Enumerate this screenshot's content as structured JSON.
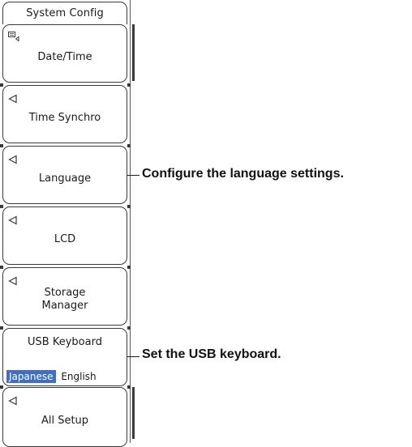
{
  "menu": {
    "title": "System Config",
    "keys": [
      {
        "label": "Date/Time",
        "icon": "menu-icon"
      },
      {
        "label": "Time Synchro",
        "icon": "left-triangle-icon"
      },
      {
        "label": "Language",
        "icon": "left-triangle-icon"
      },
      {
        "label": "LCD",
        "icon": "left-triangle-icon"
      },
      {
        "label": "Storage\nManager",
        "icon": "left-triangle-icon"
      },
      {
        "label": "USB Keyboard",
        "options": [
          "Japanese",
          "English"
        ],
        "selected": "Japanese"
      },
      {
        "label": "All Setup",
        "icon": "left-triangle-icon"
      }
    ]
  },
  "callouts": {
    "language": "Configure the language settings.",
    "usb_keyboard": "Set the USB keyboard."
  },
  "colors": {
    "selected_option_bg": "#3d6fc6",
    "border": "#3a3a3a"
  }
}
